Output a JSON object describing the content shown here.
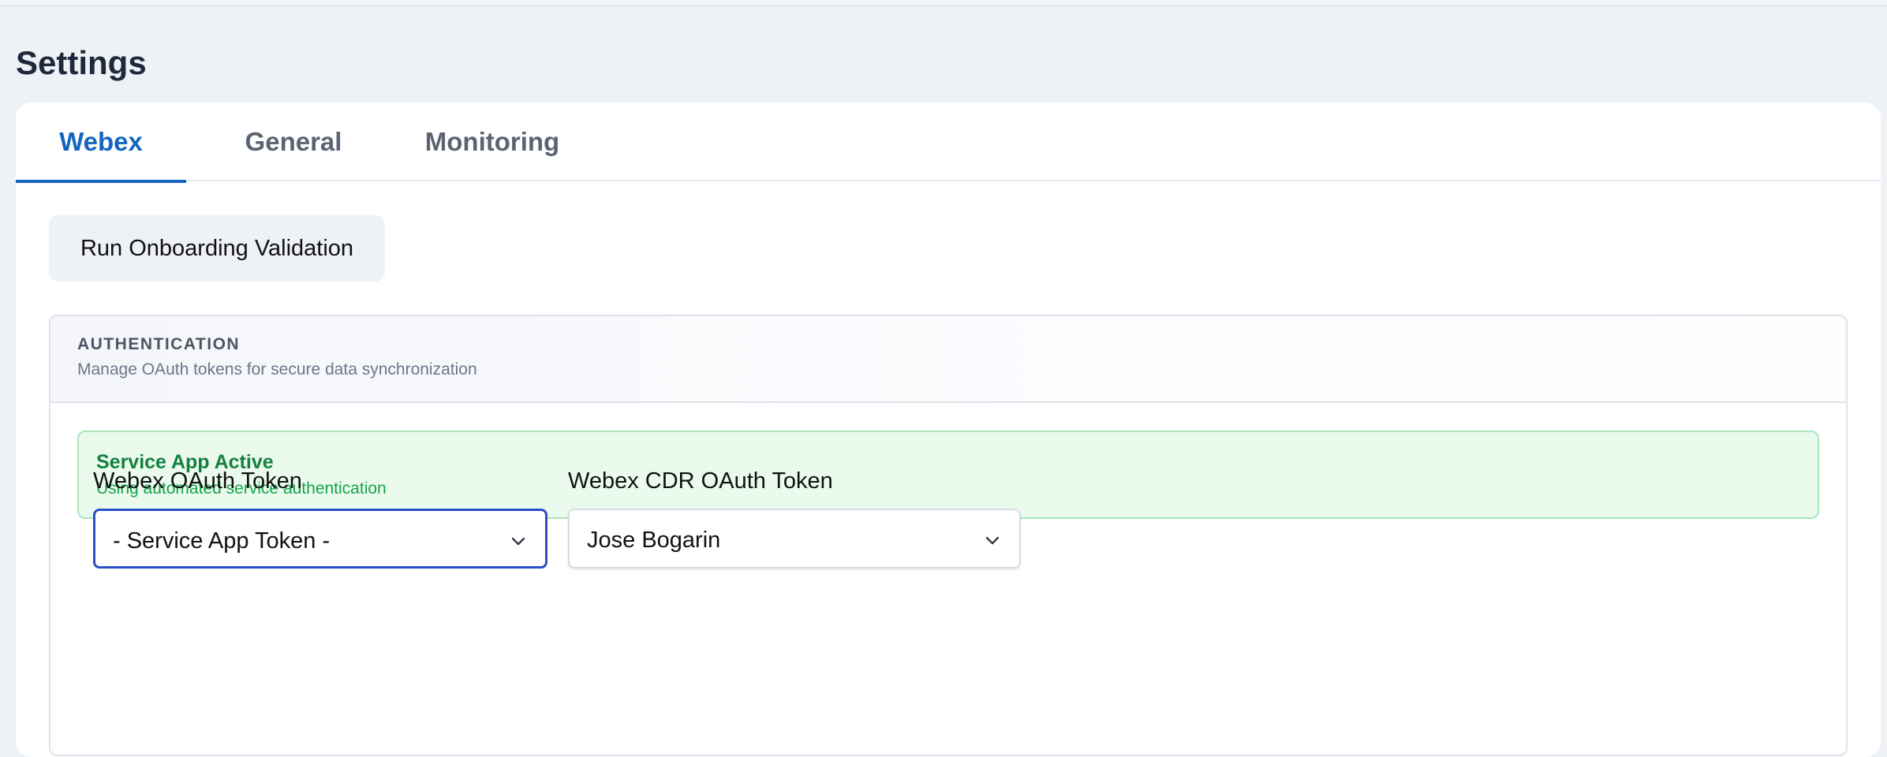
{
  "page": {
    "title": "Settings"
  },
  "tabs": [
    {
      "label": "Webex",
      "active": true
    },
    {
      "label": "General",
      "active": false
    },
    {
      "label": "Monitoring",
      "active": false
    }
  ],
  "actions": {
    "run_validation_label": "Run Onboarding Validation"
  },
  "authentication": {
    "title": "AUTHENTICATION",
    "subtitle": "Manage OAuth tokens for secure data synchronization",
    "status": {
      "title": "Service App Active",
      "text": "Using automated service authentication"
    },
    "fields": {
      "oauth_token": {
        "label": "Webex OAuth Token",
        "value": "- Service App Token -"
      },
      "cdr_oauth_token": {
        "label": "Webex CDR OAuth Token",
        "value": "Jose Bogarin"
      }
    }
  },
  "icons": {
    "select_chevron": "chevron-down-icon"
  },
  "colors": {
    "accent": "#1565c0",
    "focus_border": "#2c4ec7",
    "success_bg": "#eafbee",
    "success_text": "#15803d"
  }
}
